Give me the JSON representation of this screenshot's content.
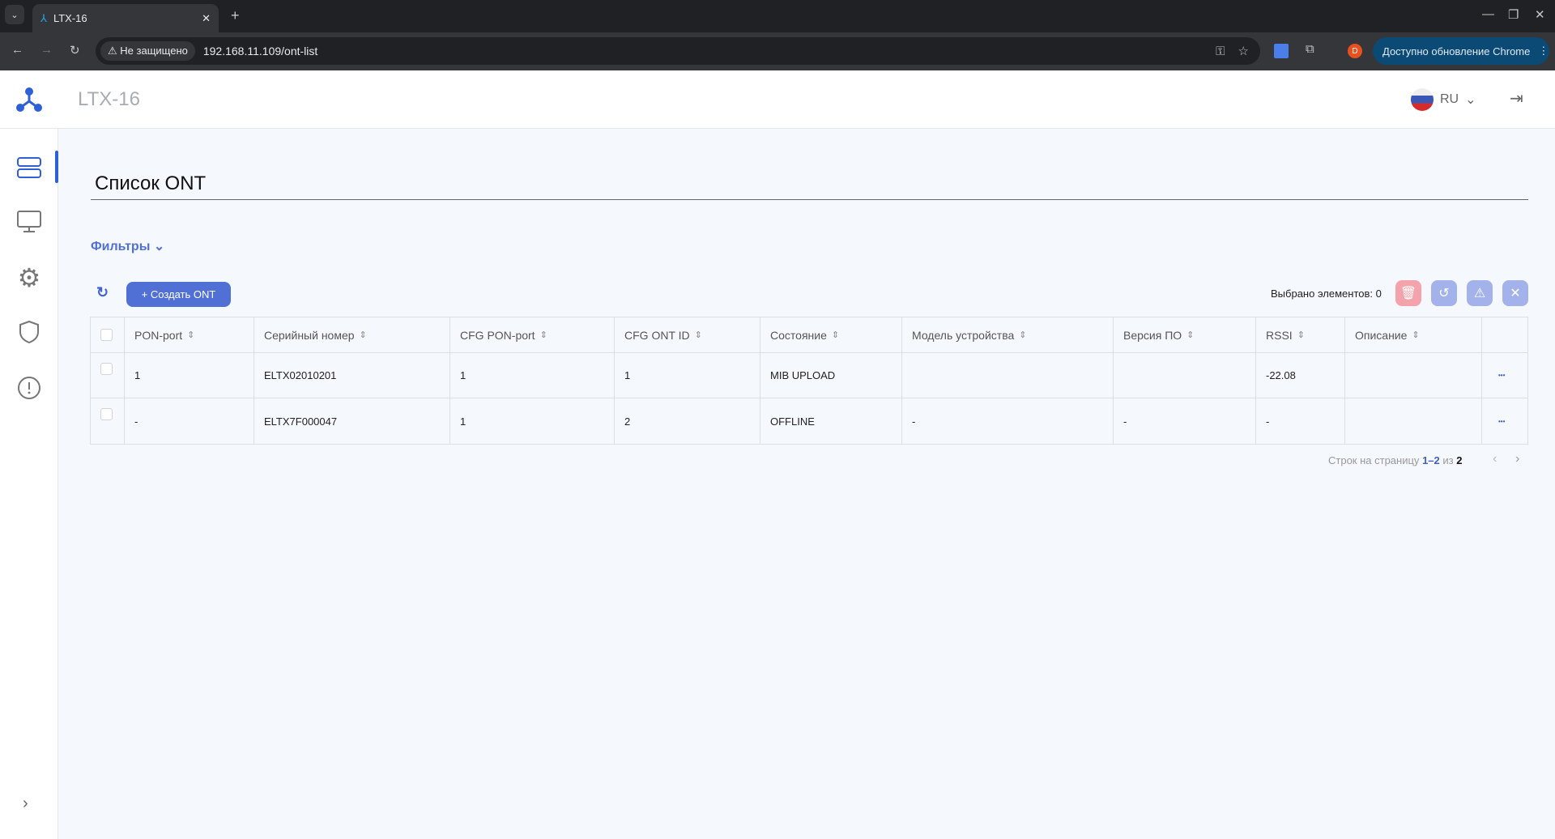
{
  "browser": {
    "tab_title": "LTX-16",
    "security_label": "Не защищено",
    "url": "192.168.11.109/ont-list",
    "profile_initial": "D",
    "update_label": "Доступно обновление Chrome"
  },
  "header": {
    "app_title": "LTX-16",
    "language": "RU"
  },
  "sidebar": {
    "items": [
      {
        "name": "ont-list",
        "active": true
      },
      {
        "name": "monitor"
      },
      {
        "name": "settings"
      },
      {
        "name": "security"
      },
      {
        "name": "alerts"
      }
    ]
  },
  "page": {
    "title": "Список ONT",
    "filters_label": "Фильтры",
    "create_button": "+ Создать ONT",
    "selected_label": "Выбрано элементов: 0"
  },
  "colors": {
    "accent": "#5170d6",
    "delete": "#f4a3ad",
    "action": "#a3b2ea"
  },
  "table": {
    "columns": [
      "PON-port",
      "Серийный номер",
      "CFG PON-port",
      "CFG ONT ID",
      "Состояние",
      "Модель устройства",
      "Версия ПО",
      "RSSI",
      "Описание"
    ],
    "rows": [
      [
        "1",
        "ELTX02010201",
        "1",
        "1",
        "MIB UPLOAD",
        "",
        "",
        "-22.08",
        ""
      ],
      [
        "-",
        "ELTX7F000047",
        "1",
        "2",
        "OFFLINE",
        "-",
        "-",
        "-",
        ""
      ]
    ]
  },
  "pagination": {
    "label": "Строк на страницу",
    "range": "1–2",
    "of": "из",
    "total": "2"
  }
}
